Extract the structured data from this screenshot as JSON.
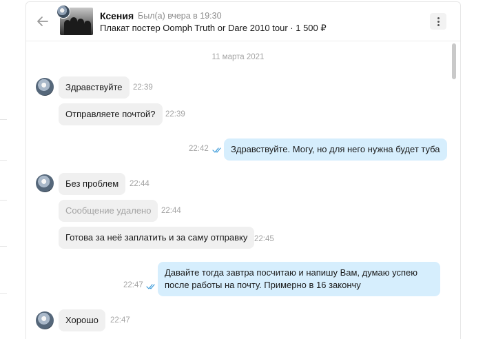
{
  "header": {
    "contact_name": "Ксения",
    "last_seen": "Был(а) вчера в 19:30",
    "listing_title": "Плакат постер Oomph Truth or Dare 2010 tour",
    "listing_separator": " · ",
    "listing_price": "1 500 ₽"
  },
  "date_separator": "11 марта 2021",
  "messages": [
    {
      "direction": "in",
      "text": "Здравствуйте",
      "time": "22:39"
    },
    {
      "direction": "in",
      "text": "Отправляете почтой?",
      "time": "22:39"
    },
    {
      "direction": "out",
      "text": "Здравствуйте. Могу, но для него нужна будет туба",
      "time": "22:42",
      "read": true
    },
    {
      "direction": "in",
      "text": "Без проблем",
      "time": "22:44"
    },
    {
      "direction": "in",
      "text": "Сообщение удалено",
      "time": "22:44",
      "deleted": true
    },
    {
      "direction": "in",
      "text": "Готова за неё заплатить и за саму отправку",
      "time": "22:45"
    },
    {
      "direction": "out",
      "text": "Давайте тогда завтра посчитаю и напишу Вам, думаю успею после работы на почту. Примерно в 16 закончу",
      "time": "22:47",
      "read": true
    },
    {
      "direction": "in",
      "text": "Хорошо",
      "time": "22:47"
    }
  ],
  "colors": {
    "incoming_bubble": "#f0f0f0",
    "outgoing_bubble": "#d6eefd",
    "read_check": "#3a9ad9",
    "muted_text": "#a3a3a3"
  },
  "icons": [
    "back-arrow-icon",
    "more-vertical-icon",
    "double-check-icon"
  ]
}
